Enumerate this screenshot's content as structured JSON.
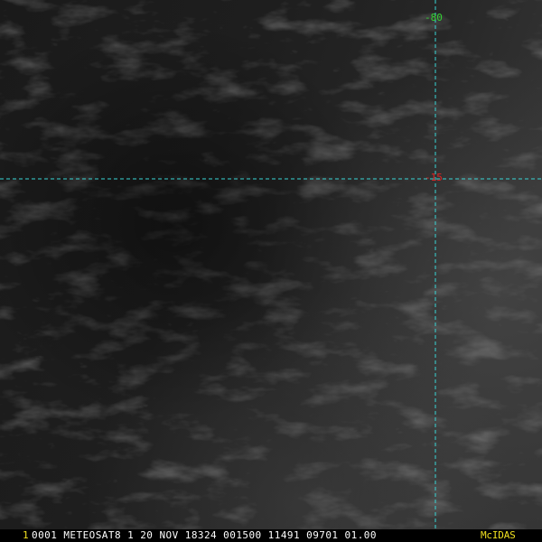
{
  "image": {
    "frame_number": "1",
    "header": "0001 METEOSAT8    1 20 NOV 18324 001500 11491 09701 01.00",
    "software": "McIDAS"
  },
  "grid": {
    "longitude_label": "-80",
    "latitude_label": "-15"
  },
  "colors": {
    "background": "#1b1b1b",
    "grid_line": "#38d6d6",
    "longitude_label": "#32d232",
    "latitude_label": "#e02424",
    "frame_number": "#f0e020",
    "header_text": "#ffffff",
    "software_badge": "#f0e020",
    "status_bar": "#000000"
  }
}
